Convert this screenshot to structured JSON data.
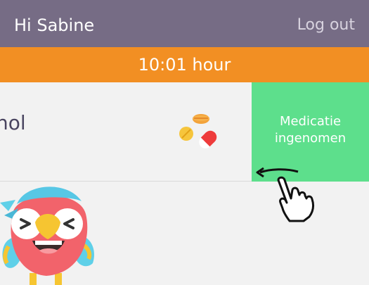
{
  "header": {
    "greeting": "Hi Sabine",
    "logout_label": "Log out"
  },
  "time_bar": {
    "time": "10:01 hour"
  },
  "medication": {
    "name_partial": "hol",
    "action_label": "Medicatie ingenomen"
  },
  "icons": {
    "pills": "pills-icon",
    "swipe": "swipe-left-hand-icon",
    "mascot": "parrot-mascot"
  },
  "colors": {
    "header": "#766c85",
    "accent_orange": "#f28f23",
    "action_green": "#5ddf8c",
    "background": "#f2f2f2"
  }
}
